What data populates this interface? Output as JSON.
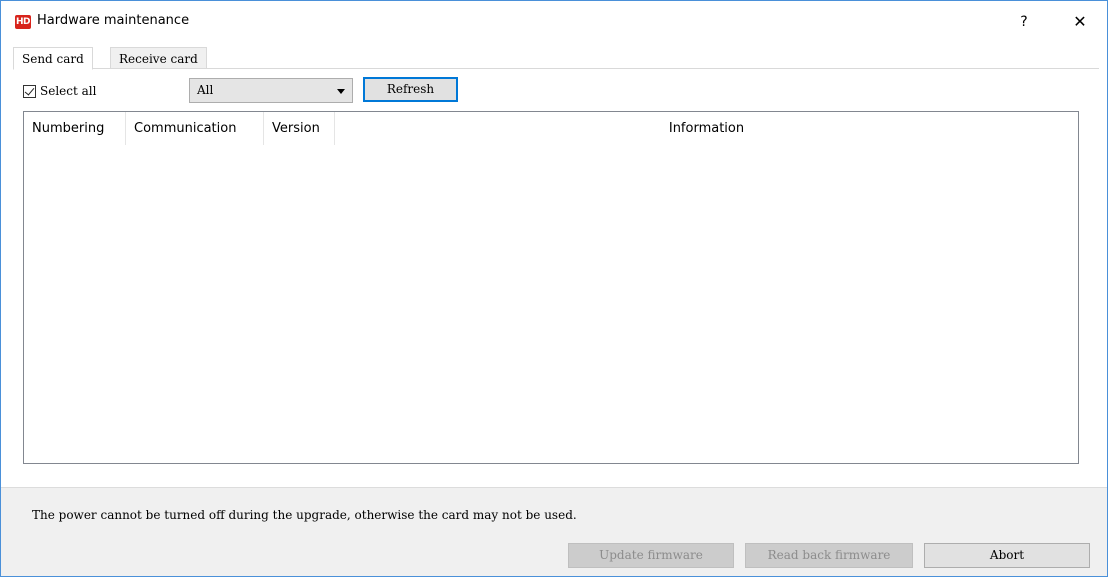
{
  "window": {
    "title": "Hardware maintenance",
    "logo_text": "HD",
    "help_label": "?",
    "close_label": "✕"
  },
  "tabs": [
    {
      "label": "Send card",
      "active": true
    },
    {
      "label": "Receive card",
      "active": false
    }
  ],
  "toolbar": {
    "select_all_label": "Select all",
    "select_all_checked": true,
    "filter_value": "All",
    "refresh_label": "Refresh"
  },
  "table": {
    "columns": [
      "Numbering",
      "Communication",
      "Version",
      "Information"
    ],
    "rows": []
  },
  "footer": {
    "notice": "The power cannot be turned off during the upgrade, otherwise the card may not be used.",
    "update_label": "Update firmware",
    "readback_label": "Read back firmware",
    "abort_label": "Abort"
  },
  "colors": {
    "accent": "#0078d7",
    "logo": "#d8241c"
  }
}
